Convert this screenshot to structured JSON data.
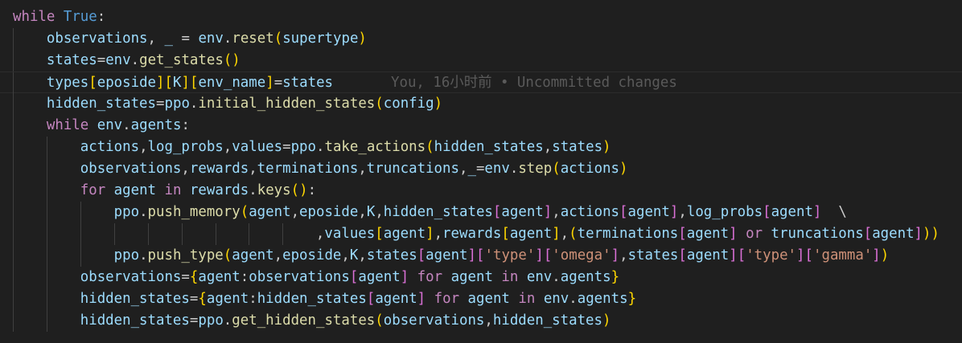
{
  "editor": {
    "blame_annotation": "You, 16小时前 • Uncommitted changes",
    "lines": [
      "while True:",
      "    observations, _ = env.reset(supertype)",
      "    states=env.get_states()",
      "    types[eposide][K][env_name]=states",
      "    hidden_states=ppo.initial_hidden_states(config)",
      "    while env.agents:",
      "        actions,log_probs,values=ppo.take_actions(hidden_states,states)",
      "        observations,rewards,terminations,truncations,_=env.step(actions)",
      "        for agent in rewards.keys():",
      "            ppo.push_memory(agent,eposide,K,hidden_states[agent],actions[agent],log_probs[agent]  \\",
      "                                    ,values[agent],rewards[agent],(terminations[agent] or truncations[agent]))",
      "            ppo.push_type(agent,eposide,K,states[agent]['type']['omega'],states[agent]['type']['gamma'])",
      "        observations={agent:observations[agent] for agent in env.agents}",
      "        hidden_states={agent:hidden_states[agent] for agent in env.agents}",
      "        hidden_states=ppo.get_hidden_states(observations,hidden_states)"
    ]
  },
  "theme": {
    "background": "#1f1f1f",
    "keyword": "#c586c0",
    "constant": "#569cd6",
    "variable": "#9cdcfe",
    "function": "#dcdcaa",
    "string": "#ce9178",
    "bracket_1": "#ffd700",
    "bracket_2": "#da70d6",
    "bracket_3": "#179fff"
  }
}
